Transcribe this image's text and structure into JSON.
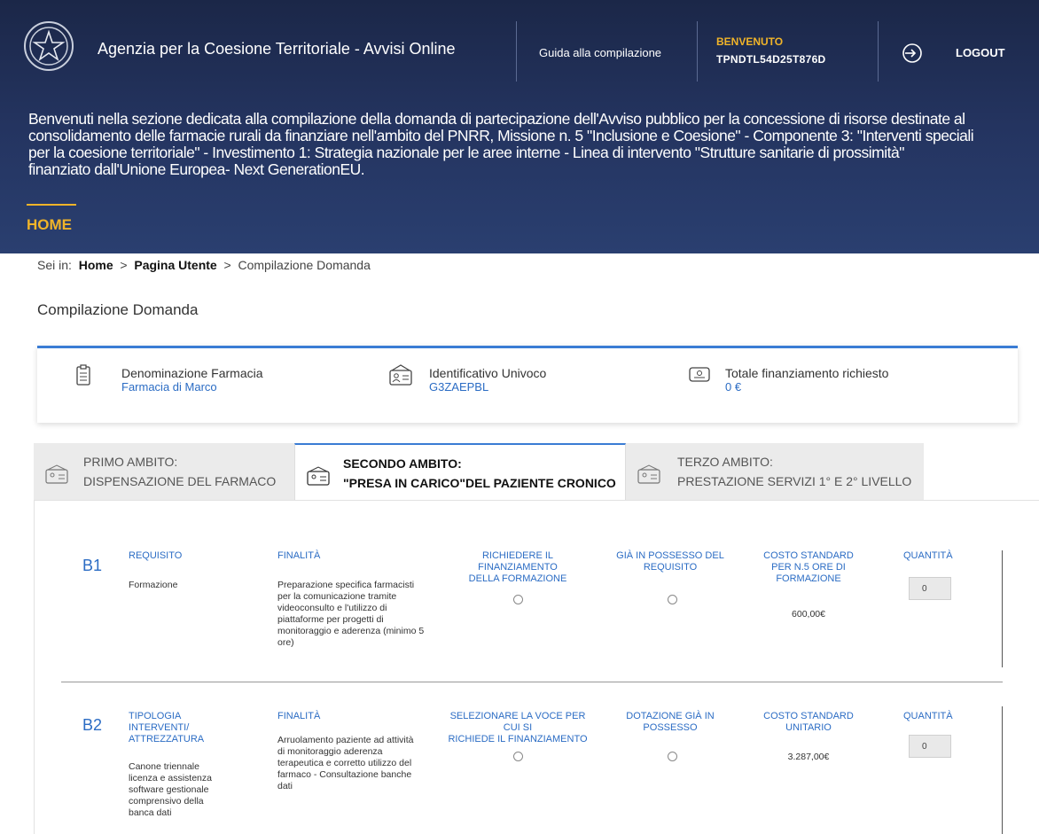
{
  "header": {
    "app_title": "Agenzia per la Coesione Territoriale - Avvisi Online",
    "guide_link": "Guida alla compilazione",
    "welcome_label": "BENVENUTO",
    "user_code": "TPNDTL54D25T876D",
    "logout_label": "LOGOUT",
    "intro_lines": [
      "Benvenuti nella sezione dedicata alla compilazione della domanda di partecipazione dell'Avviso pubblico per la concessione di risorse destinate al",
      "consolidamento delle farmacie rurali da finanziare nell'ambito del PNRR, Missione n. 5 \"Inclusione e Coesione\" - Componente 3: \"Interventi speciali",
      "per la coesione territoriale\" - Investimento 1: Strategia nazionale per le aree interne - Linea di intervento \"Strutture sanitarie di prossimità\"",
      "finanziato dall'Unione Europea- Next GenerationEU."
    ],
    "nav_home": "HOME"
  },
  "breadcrumb": {
    "prefix": "Sei in:",
    "home": "Home",
    "sep": ">",
    "user_page": "Pagina Utente",
    "current": "Compilazione Domanda"
  },
  "page_title": "Compilazione Domanda",
  "summary": {
    "pharmacy_label": "Denominazione Farmacia",
    "pharmacy_value": "Farmacia di Marco",
    "id_label": "Identificativo Univoco",
    "id_value": "G3ZAEPBL",
    "total_label": "Totale finanziamento richiesto",
    "total_value": "0 €"
  },
  "tabs": [
    {
      "line1": "PRIMO AMBITO:",
      "line2": "DISPENSAZIONE DEL FARMACO"
    },
    {
      "line1": "SECONDO AMBITO:",
      "line2": "\"PRESA IN CARICO\"DEL PAZIENTE CRONICO"
    },
    {
      "line1": "TERZO AMBITO:",
      "line2": "PRESTAZIONE SERVIZI 1° E 2° LIVELLO"
    }
  ],
  "rows": [
    {
      "code": "B1",
      "col1_header": [
        "REQUISITO"
      ],
      "col1_value": [
        "Formazione"
      ],
      "col2_header": "FINALITÀ",
      "col2_value": [
        "Preparazione specifica farmacisti",
        "per la comunicazione tramite",
        "videoconsulto e l'utilizzo di",
        "piattaforme per progetti di",
        "monitoraggio e aderenza (minimo 5",
        "ore)"
      ],
      "col3_header": [
        "RICHIEDERE IL FINANZIAMENTO",
        "DELLA FORMAZIONE"
      ],
      "col4_header": [
        "GIÀ IN POSSESSO DEL",
        "REQUISITO"
      ],
      "col5_header": [
        "COSTO STANDARD",
        "PER N.5 ORE DI",
        "FORMAZIONE"
      ],
      "cost": "600,00€",
      "qty_header": "QUANTITÀ",
      "qty_value": "0"
    },
    {
      "code": "B2",
      "col1_header": [
        "TIPOLOGIA",
        "INTERVENTI/",
        "ATTREZZATURA"
      ],
      "col1_value": [
        "Canone triennale",
        "licenza e assistenza",
        "software gestionale",
        "comprensivo della",
        "banca dati"
      ],
      "col2_header": "FINALITÀ",
      "col2_value": [
        "Arruolamento paziente ad attività",
        "di monitoraggio aderenza",
        "terapeutica e corretto utilizzo del",
        "farmaco - Consultazione banche",
        "dati"
      ],
      "col3_header": [
        "SELEZIONARE LA VOCE PER CUI SI",
        "RICHIEDE IL FINANZIAMENTO"
      ],
      "col4_header": [
        "DOTAZIONE GIÀ IN",
        "POSSESSO"
      ],
      "col5_header": [
        "COSTO STANDARD",
        "UNITARIO"
      ],
      "cost": "3.287,00€",
      "qty_header": "QUANTITÀ",
      "qty_value": "0"
    }
  ]
}
